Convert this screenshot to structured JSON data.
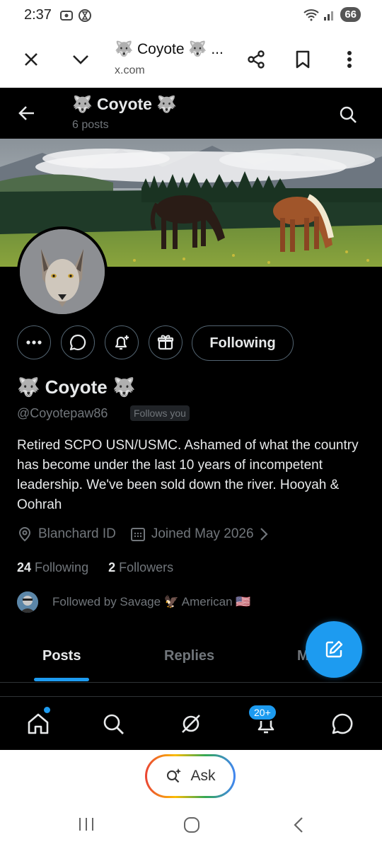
{
  "status": {
    "time": "2:37",
    "battery": "66"
  },
  "browser": {
    "title": "🐺 Coyote 🐺 ...",
    "url": "x.com"
  },
  "header": {
    "name": "🐺 Coyote 🐺",
    "posts": "6 posts"
  },
  "profile": {
    "display_name": "🐺 Coyote 🐺",
    "handle": "@Coyotepaw86",
    "follows_you": "Follows you",
    "bio": "Retired SCPO USN/USMC. Ashamed of what the country has become under the last 10 years of incompetent leadership. We've been sold down the river. Hooyah & Oohrah",
    "location": "Blanchard ID",
    "joined": "Joined May 2026",
    "following_count": "24",
    "following_label": "Following",
    "followers_count": "2",
    "followers_label": "Followers",
    "followed_by": "Followed by Savage 🦅 American 🇺🇸",
    "following_button": "Following"
  },
  "tabs": [
    {
      "label": "Posts",
      "active": true
    },
    {
      "label": "Replies",
      "active": false
    },
    {
      "label": "M",
      "active": false
    }
  ],
  "nav": {
    "notifications_badge": "20+"
  },
  "ask": {
    "label": "Ask"
  },
  "colors": {
    "accent": "#1d9bf0",
    "background": "#000000",
    "text": "#e7e9ea",
    "muted": "#71767b"
  }
}
